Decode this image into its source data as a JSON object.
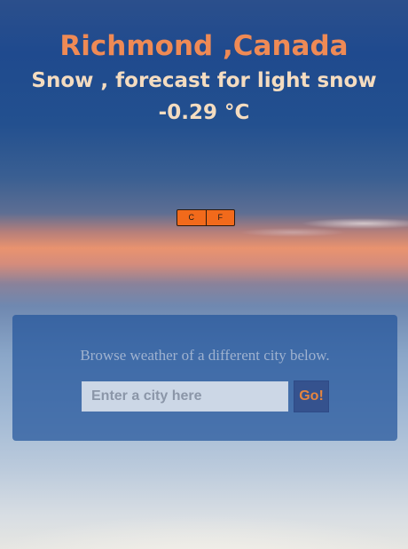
{
  "weather": {
    "location": "Richmond ,Canada",
    "description": "Snow , forecast for light snow",
    "temperature": "-0.29 °C"
  },
  "unit_toggle": {
    "celsius_label": "C",
    "fahrenheit_label": "F"
  },
  "search_panel": {
    "prompt": "Browse weather of a different city below.",
    "input_placeholder": "Enter a city here",
    "input_value": "",
    "button_label": "Go!"
  },
  "colors": {
    "city": "#ef8a55",
    "details": "#f4dcc0",
    "toggle": "#f26a1b",
    "panel": "#23559b",
    "button_text": "#e6853f"
  }
}
